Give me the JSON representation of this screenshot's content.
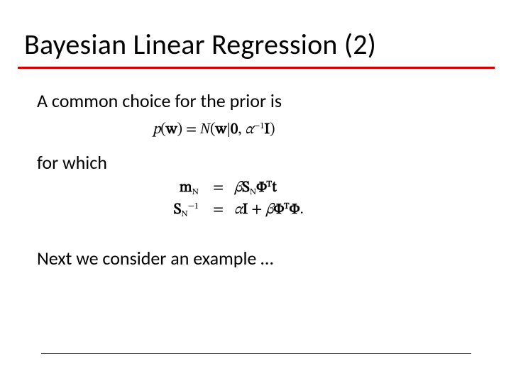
{
  "title": "Bayesian Linear Regression (2)",
  "lines": {
    "l1": "A common choice for the prior is",
    "l2": "for which",
    "l3": "Next we consider an example …"
  },
  "equations": {
    "prior": {
      "p": "p",
      "open": "(",
      "w": "w",
      "close": ")",
      "eq": " = ",
      "N": "N",
      "open2": "(",
      "bar": "|",
      "zero": "0",
      "comma": ", ",
      "alpha": "α",
      "neg1": "−1",
      "I": "I",
      "close2": ")"
    },
    "posterior": {
      "m": "m",
      "N_sub": "N",
      "eq": "=",
      "beta": "β",
      "S": "S",
      "Phi": "Φ",
      "T": "T",
      "t": "t",
      "Sinv_neg1": "−1",
      "alpha": "α",
      "I": "I",
      "plus": " + ",
      "period": "."
    }
  }
}
